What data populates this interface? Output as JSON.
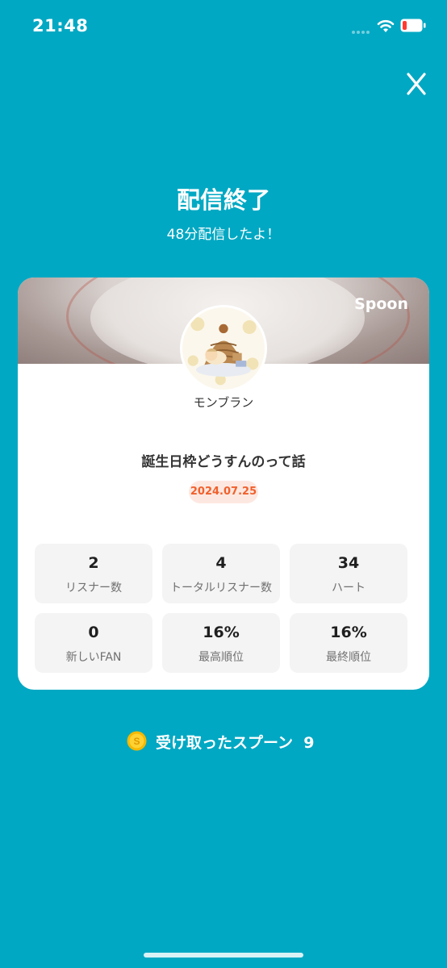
{
  "status_bar": {
    "time": "21:48"
  },
  "header": {
    "title": "配信終了",
    "subtitle": "48分配信したよ！"
  },
  "card": {
    "brand": "Spoon",
    "dj_name": "モンブラン",
    "live_title": "誕生日枠どうすんのって話",
    "date": "2024.07.25",
    "stats": [
      {
        "value": "2",
        "label": "リスナー数"
      },
      {
        "value": "4",
        "label": "トータルリスナー数"
      },
      {
        "value": "34",
        "label": "ハート"
      },
      {
        "value": "0",
        "label": "新しいFAN"
      },
      {
        "value": "16%",
        "label": "最高順位"
      },
      {
        "value": "16%",
        "label": "最終順位"
      }
    ]
  },
  "footer": {
    "spoons_text": "受け取ったスプーン  9"
  },
  "colors": {
    "background": "#00a8c3",
    "date_text": "#f0602c",
    "date_bg": "#fde8e1",
    "coin": "#f5b800"
  },
  "icons": [
    "close-icon",
    "coin-icon",
    "wifi-icon",
    "battery-icon",
    "signal-icon"
  ]
}
